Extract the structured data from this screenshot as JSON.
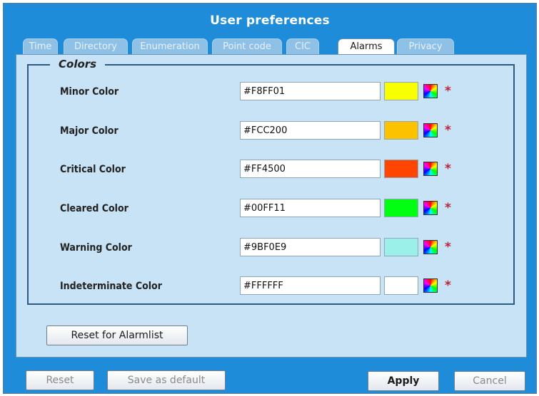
{
  "window": {
    "title": "User preferences"
  },
  "tabs": [
    {
      "label": "Time"
    },
    {
      "label": "Directory"
    },
    {
      "label": "Enumeration"
    },
    {
      "label": "Point code"
    },
    {
      "label": "CIC"
    },
    {
      "label": "Alarms",
      "active": true
    },
    {
      "label": "Privacy"
    }
  ],
  "colors_section": {
    "legend": "Colors",
    "required_marker": "*",
    "rows": [
      {
        "label": "Minor Color",
        "value": "#F8FF01",
        "swatch": "#F8FF01"
      },
      {
        "label": "Major Color",
        "value": "#FCC200",
        "swatch": "#FCC200"
      },
      {
        "label": "Critical Color",
        "value": "#FF4500",
        "swatch": "#FF4500"
      },
      {
        "label": "Cleared Color",
        "value": "#00FF11",
        "swatch": "#00FF11"
      },
      {
        "label": "Warning Color",
        "value": "#9BF0E9",
        "swatch": "#9BF0E9"
      },
      {
        "label": "Indeterminate Color",
        "value": "#FFFFFF",
        "swatch": "#FFFFFF"
      }
    ],
    "picker_icon": "color-palette-icon"
  },
  "reset_alarmlist_label": "Reset for Alarmlist",
  "footer": {
    "reset_label": "Reset",
    "save_default_label": "Save as default",
    "apply_label": "Apply",
    "cancel_label": "Cancel"
  },
  "theme": {
    "frame_blue": "#1e8cd8",
    "panel_bg": "#c7e3f5",
    "required_red": "#c0213a"
  }
}
